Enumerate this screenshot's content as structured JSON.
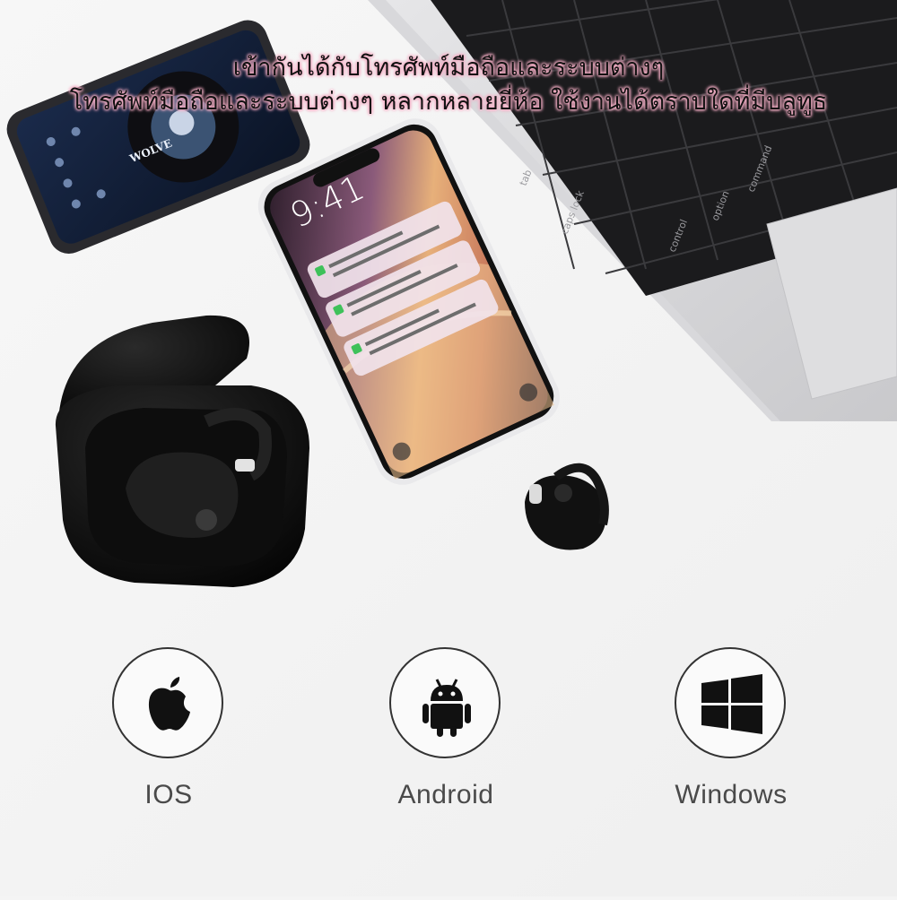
{
  "headline": {
    "line1": "เข้ากันได้กับโทรศัพท์มือถือและระบบต่างๆ",
    "line2": "โทรศัพท์มือถือและระบบต่างๆ หลากหลายยี่ห้อ ใช้งานได้ตราบใดที่มีบลูทูธ"
  },
  "phone": {
    "clock": "9:41"
  },
  "music_player": {
    "album_text": "WOLVE"
  },
  "laptop": {
    "keys": [
      "tab",
      "caps lock",
      "control",
      "option",
      "command"
    ]
  },
  "os": [
    {
      "label": "IOS",
      "icon": "apple-icon"
    },
    {
      "label": "Android",
      "icon": "android-icon"
    },
    {
      "label": "Windows",
      "icon": "windows-icon"
    }
  ],
  "colors": {
    "headline_glow": "#f6b2c8",
    "background": "#f4f4f4",
    "circle_border": "#333333",
    "label": "#4a4a4a"
  }
}
